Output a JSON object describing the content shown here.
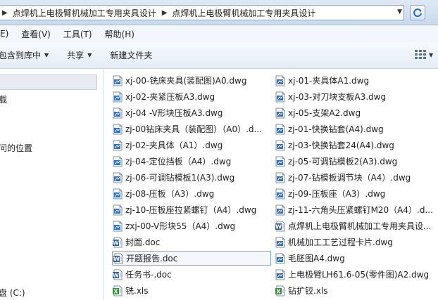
{
  "address": {
    "crumbs": [
      "点焊机上电极臂机械加工专用夹具设计",
      "点焊机上电极臂机械加工专用夹具设计"
    ]
  },
  "menu": [
    "E)",
    "查看(V)",
    "工具(T)",
    "帮助(H)"
  ],
  "toolbar": {
    "include_label": "包含到库中",
    "share_label": "共享",
    "new_folder_label": "新建文件夹"
  },
  "sidebar": {
    "items": [
      "载",
      "问的位置",
      "盘 (C:)"
    ]
  },
  "files": [
    {
      "name": "xj-00-铣床夹具(装配图)A0.dwg",
      "type": "dwg"
    },
    {
      "name": "xj-01-夹具体A1.dwg",
      "type": "dwg"
    },
    {
      "name": "xj-02-夹紧压板A3.dwg",
      "type": "dwg"
    },
    {
      "name": "xj-03-对刀块支板A3.dwg",
      "type": "dwg"
    },
    {
      "name": "xj-04 -V形块压板A3.dwg",
      "type": "dwg"
    },
    {
      "name": "xj-05-支架A2.dwg",
      "type": "dwg"
    },
    {
      "name": "zj-00钻床夹具（装配图）（A0）.d...",
      "type": "dwg"
    },
    {
      "name": "zj-01-快换钻套(A4).dwg",
      "type": "dwg"
    },
    {
      "name": "zj-02-夹具体（A1）.dwg",
      "type": "dwg"
    },
    {
      "name": "zj-03-快换钻套24(A4).dwg",
      "type": "dwg"
    },
    {
      "name": "zj-04-定位挡板（A4）.dwg",
      "type": "dwg"
    },
    {
      "name": "zj-05-可调钻模板2(A3).dwg",
      "type": "dwg"
    },
    {
      "name": "zj-06-可调钻模板1(A3).dwg",
      "type": "dwg"
    },
    {
      "name": "zj-07-钻模板调节块（A4）.dwg",
      "type": "dwg"
    },
    {
      "name": "zj-08-压板（A3）.dwg",
      "type": "dwg"
    },
    {
      "name": "zj-09-压板座（A3）.dwg",
      "type": "dwg"
    },
    {
      "name": "zj-10-压板座拉紧螺钉（A4）.dwg",
      "type": "dwg"
    },
    {
      "name": "zj-11-六角头压紧螺钉M20（A4）.d...",
      "type": "dwg"
    },
    {
      "name": "zxj-00-V形块55（A4）.dwg",
      "type": "dwg"
    },
    {
      "name": "点焊机上电极臂机械加工专用夹具设...",
      "type": "doc"
    },
    {
      "name": "封面.doc",
      "type": "doc"
    },
    {
      "name": "机械加工工艺过程卡片.dwg",
      "type": "dwg"
    },
    {
      "name": "开题报告.doc",
      "type": "doc",
      "selected": true
    },
    {
      "name": "毛胚图A4.dwg",
      "type": "dwg"
    },
    {
      "name": "任务书-.doc",
      "type": "doc"
    },
    {
      "name": "上电极臂LH61.6-05(零件图)A2.dwg",
      "type": "dwg"
    },
    {
      "name": "铣.xls",
      "type": "xls"
    },
    {
      "name": "钻扩铰.xls",
      "type": "xls"
    }
  ],
  "colors": {
    "dwg_icon": "#2f6fc0",
    "doc_icon": "#2b5797",
    "xls_icon": "#3a8d3a",
    "selection_border": "#7da2ce"
  }
}
